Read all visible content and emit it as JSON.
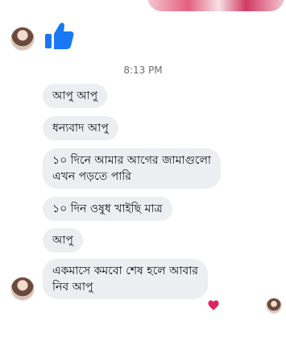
{
  "conversation": {
    "timestamp": "8:13 PM",
    "reaction_icon": "thumbs-up-icon",
    "messages": [
      {
        "text": "আপু আপু"
      },
      {
        "text": "ধন্যবাদ আপু"
      },
      {
        "lines": [
          "১০ দিনে আমার আগের জামাগুলো",
          "এখন পড়তে পারি"
        ]
      },
      {
        "text": "১০ দিন ওষুধ খাইছি মাত্র"
      },
      {
        "text": "আপু"
      },
      {
        "lines": [
          "একমাসে কমবো শেষ হলে আবার",
          "নিব আপু"
        ]
      }
    ],
    "last_message_reaction": "heart-icon"
  },
  "colors": {
    "bubble_background": "#eceef1",
    "thumb_blue": "#1877f2",
    "heart_red": "#e0245e"
  }
}
